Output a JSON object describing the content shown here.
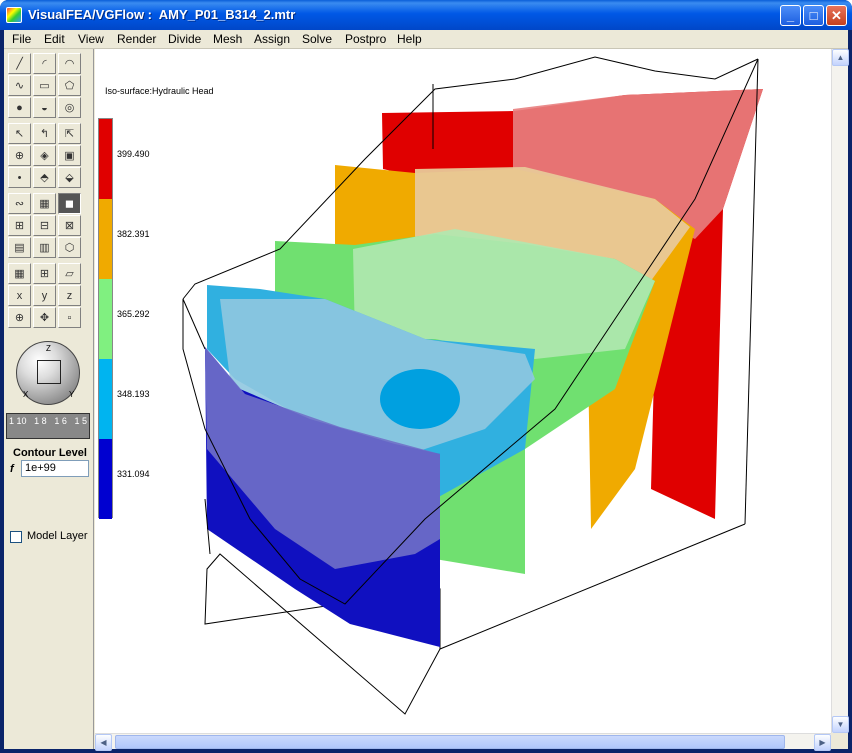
{
  "window": {
    "title": "VisualFEA/VGFlow :  AMY_P01_B314_2.mtr"
  },
  "title_buttons": {
    "minimize": "_",
    "maximize": "□",
    "close": "✕"
  },
  "menu": [
    "File",
    "Edit",
    "View",
    "Render",
    "Divide",
    "Mesh",
    "Assign",
    "Solve",
    "Postpro",
    "Help"
  ],
  "navigator": {
    "z_label": "Z",
    "x_label": "X",
    "y_label": "Y"
  },
  "zoom_slider": {
    "ticks": [
      "1\n10",
      "1\n8",
      "1\n6",
      "1\n5"
    ]
  },
  "contour": {
    "label": "Contour Level",
    "f_label": "f",
    "value": "1e+99"
  },
  "model_layer": {
    "label": "Model Layer",
    "checked": false
  },
  "plot": {
    "title": "Iso-surface:Hydraulic Head",
    "legend": [
      {
        "value": "399.490",
        "color": "#e00000"
      },
      {
        "value": "382.391",
        "color": "#f0aa00"
      },
      {
        "value": "365.292",
        "color": "#80f080"
      },
      {
        "value": "348.193",
        "color": "#00b4f0"
      },
      {
        "value": "331.094",
        "color": "#0000d0"
      }
    ]
  }
}
